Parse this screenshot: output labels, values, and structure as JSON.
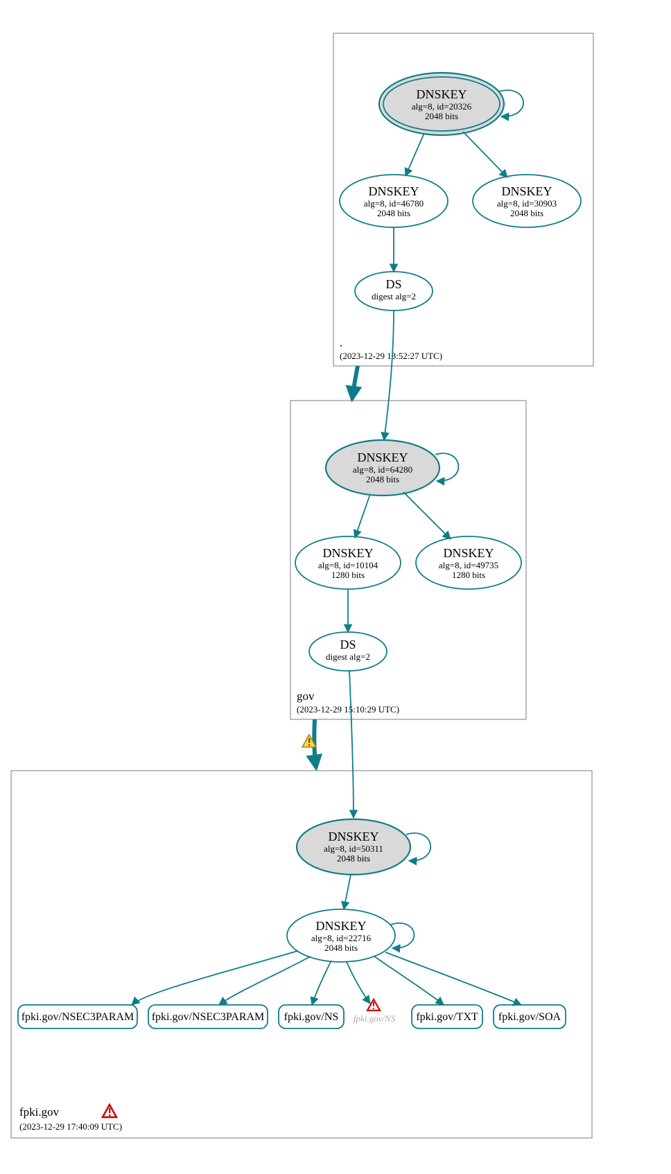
{
  "colors": {
    "teal": "#0f7d89",
    "nodeFill": "#d9d9d9",
    "warnFill": "#ffd24d",
    "warnStroke": "#b58900",
    "errFill": "#ffffff",
    "errStroke": "#cc0000"
  },
  "zones": {
    "root": {
      "name": ".",
      "timestamp": "(2023-12-29 13:52:27 UTC)"
    },
    "gov": {
      "name": "gov",
      "timestamp": "(2023-12-29 15:10:29 UTC)"
    },
    "fpki": {
      "name": "fpki.gov",
      "timestamp": "(2023-12-29 17:40:09 UTC)"
    }
  },
  "nodes": {
    "root_ksk": {
      "title": "DNSKEY",
      "l1": "alg=8, id=20326",
      "l2": "2048 bits"
    },
    "root_zsk1": {
      "title": "DNSKEY",
      "l1": "alg=8, id=46780",
      "l2": "2048 bits"
    },
    "root_zsk2": {
      "title": "DNSKEY",
      "l1": "alg=8, id=30903",
      "l2": "2048 bits"
    },
    "root_ds": {
      "title": "DS",
      "l1": "digest alg=2",
      "l2": ""
    },
    "gov_ksk": {
      "title": "DNSKEY",
      "l1": "alg=8, id=64280",
      "l2": "2048 bits"
    },
    "gov_zsk1": {
      "title": "DNSKEY",
      "l1": "alg=8, id=10104",
      "l2": "1280 bits"
    },
    "gov_zsk2": {
      "title": "DNSKEY",
      "l1": "alg=8, id=49735",
      "l2": "1280 bits"
    },
    "gov_ds": {
      "title": "DS",
      "l1": "digest alg=2",
      "l2": ""
    },
    "fpki_ksk": {
      "title": "DNSKEY",
      "l1": "alg=8, id=50311",
      "l2": "2048 bits"
    },
    "fpki_zsk": {
      "title": "DNSKEY",
      "l1": "alg=8, id=22716",
      "l2": "2048 bits"
    }
  },
  "rrsets": {
    "r1": "fpki.gov/NSEC3PARAM",
    "r2": "fpki.gov/NSEC3PARAM",
    "r3": "fpki.gov/NS",
    "r4": "fpki.gov/NS",
    "r5": "fpki.gov/TXT",
    "r6": "fpki.gov/SOA"
  }
}
